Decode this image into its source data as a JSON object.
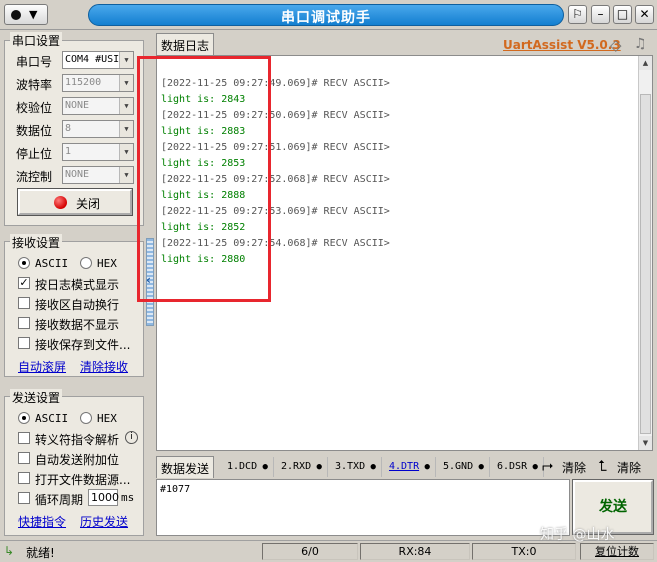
{
  "window": {
    "title": "串口调试助手",
    "brand": "UartAssist V5.0.3"
  },
  "serial": {
    "group_title": "串口设置",
    "port_label": "串口号",
    "port_value": "COM4 #USI",
    "baud_label": "波特率",
    "baud_value": "115200",
    "parity_label": "校验位",
    "parity_value": "NONE",
    "databits_label": "数据位",
    "databits_value": "8",
    "stopbits_label": "停止位",
    "stopbits_value": "1",
    "flow_label": "流控制",
    "flow_value": "NONE",
    "close_label": "关闭"
  },
  "receive": {
    "group_title": "接收设置",
    "ascii_label": "ASCII",
    "hex_label": "HEX",
    "log_mode_label": "按日志模式显示",
    "auto_wrap_label": "接收区自动换行",
    "hide_data_label": "接收数据不显示",
    "save_file_label": "接收保存到文件...",
    "auto_scroll_link": "自动滚屏",
    "clear_link": "清除接收"
  },
  "send": {
    "group_title": "发送设置",
    "ascii_label": "ASCII",
    "hex_label": "HEX",
    "escape_label": "转义符指令解析",
    "auto_append_label": "自动发送附加位",
    "open_file_label": "打开文件数据源...",
    "loop_label": "循环周期",
    "loop_value": "1000",
    "loop_unit": "ms",
    "shortcut_link": "快捷指令",
    "history_link": "历史发送"
  },
  "log": {
    "tab_label": "数据日志",
    "lines": [
      {
        "kind": "hdr",
        "text": "[2022-11-25 09:27:49.069]# RECV ASCII>"
      },
      {
        "kind": "dat",
        "text": "light is: 2843"
      },
      {
        "kind": "hdr",
        "text": "[2022-11-25 09:27:50.069]# RECV ASCII>"
      },
      {
        "kind": "dat",
        "text": "light is: 2883"
      },
      {
        "kind": "hdr",
        "text": "[2022-11-25 09:27:51.069]# RECV ASCII>"
      },
      {
        "kind": "dat",
        "text": "light is: 2853"
      },
      {
        "kind": "hdr",
        "text": "[2022-11-25 09:27:52.068]# RECV ASCII>"
      },
      {
        "kind": "dat",
        "text": "light is: 2888"
      },
      {
        "kind": "hdr",
        "text": "[2022-11-25 09:27:53.069]# RECV ASCII>"
      },
      {
        "kind": "dat",
        "text": "light is: 2852"
      },
      {
        "kind": "hdr",
        "text": "[2022-11-25 09:27:54.068]# RECV ASCII>"
      },
      {
        "kind": "dat",
        "text": "light is: 2880"
      }
    ]
  },
  "send_area": {
    "tab_label": "数据发送",
    "signals": [
      "1.DCD",
      "2.RXD",
      "3.TXD",
      "4.DTR",
      "5.GND",
      "6.DSR"
    ],
    "clear1_label": "清除",
    "clear2_label": "清除",
    "input_value": "#1077",
    "send_label": "发送"
  },
  "status": {
    "ready": "就绪!",
    "count": "6/0",
    "rx": "RX:84",
    "tx": "TX:0",
    "reset_label": "复位计数"
  },
  "watermark": "知乎 @山水"
}
